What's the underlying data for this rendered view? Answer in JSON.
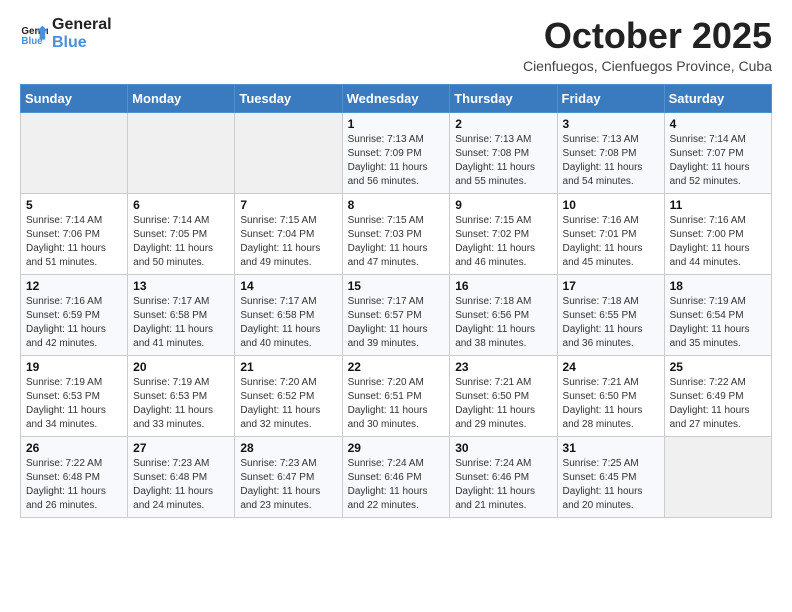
{
  "header": {
    "logo_line1": "General",
    "logo_line2": "Blue",
    "month_title": "October 2025",
    "subtitle": "Cienfuegos, Cienfuegos Province, Cuba"
  },
  "days_of_week": [
    "Sunday",
    "Monday",
    "Tuesday",
    "Wednesday",
    "Thursday",
    "Friday",
    "Saturday"
  ],
  "weeks": [
    [
      {
        "day": "",
        "info": ""
      },
      {
        "day": "",
        "info": ""
      },
      {
        "day": "",
        "info": ""
      },
      {
        "day": "1",
        "info": "Sunrise: 7:13 AM\nSunset: 7:09 PM\nDaylight: 11 hours and 56 minutes."
      },
      {
        "day": "2",
        "info": "Sunrise: 7:13 AM\nSunset: 7:08 PM\nDaylight: 11 hours and 55 minutes."
      },
      {
        "day": "3",
        "info": "Sunrise: 7:13 AM\nSunset: 7:08 PM\nDaylight: 11 hours and 54 minutes."
      },
      {
        "day": "4",
        "info": "Sunrise: 7:14 AM\nSunset: 7:07 PM\nDaylight: 11 hours and 52 minutes."
      }
    ],
    [
      {
        "day": "5",
        "info": "Sunrise: 7:14 AM\nSunset: 7:06 PM\nDaylight: 11 hours and 51 minutes."
      },
      {
        "day": "6",
        "info": "Sunrise: 7:14 AM\nSunset: 7:05 PM\nDaylight: 11 hours and 50 minutes."
      },
      {
        "day": "7",
        "info": "Sunrise: 7:15 AM\nSunset: 7:04 PM\nDaylight: 11 hours and 49 minutes."
      },
      {
        "day": "8",
        "info": "Sunrise: 7:15 AM\nSunset: 7:03 PM\nDaylight: 11 hours and 47 minutes."
      },
      {
        "day": "9",
        "info": "Sunrise: 7:15 AM\nSunset: 7:02 PM\nDaylight: 11 hours and 46 minutes."
      },
      {
        "day": "10",
        "info": "Sunrise: 7:16 AM\nSunset: 7:01 PM\nDaylight: 11 hours and 45 minutes."
      },
      {
        "day": "11",
        "info": "Sunrise: 7:16 AM\nSunset: 7:00 PM\nDaylight: 11 hours and 44 minutes."
      }
    ],
    [
      {
        "day": "12",
        "info": "Sunrise: 7:16 AM\nSunset: 6:59 PM\nDaylight: 11 hours and 42 minutes."
      },
      {
        "day": "13",
        "info": "Sunrise: 7:17 AM\nSunset: 6:58 PM\nDaylight: 11 hours and 41 minutes."
      },
      {
        "day": "14",
        "info": "Sunrise: 7:17 AM\nSunset: 6:58 PM\nDaylight: 11 hours and 40 minutes."
      },
      {
        "day": "15",
        "info": "Sunrise: 7:17 AM\nSunset: 6:57 PM\nDaylight: 11 hours and 39 minutes."
      },
      {
        "day": "16",
        "info": "Sunrise: 7:18 AM\nSunset: 6:56 PM\nDaylight: 11 hours and 38 minutes."
      },
      {
        "day": "17",
        "info": "Sunrise: 7:18 AM\nSunset: 6:55 PM\nDaylight: 11 hours and 36 minutes."
      },
      {
        "day": "18",
        "info": "Sunrise: 7:19 AM\nSunset: 6:54 PM\nDaylight: 11 hours and 35 minutes."
      }
    ],
    [
      {
        "day": "19",
        "info": "Sunrise: 7:19 AM\nSunset: 6:53 PM\nDaylight: 11 hours and 34 minutes."
      },
      {
        "day": "20",
        "info": "Sunrise: 7:19 AM\nSunset: 6:53 PM\nDaylight: 11 hours and 33 minutes."
      },
      {
        "day": "21",
        "info": "Sunrise: 7:20 AM\nSunset: 6:52 PM\nDaylight: 11 hours and 32 minutes."
      },
      {
        "day": "22",
        "info": "Sunrise: 7:20 AM\nSunset: 6:51 PM\nDaylight: 11 hours and 30 minutes."
      },
      {
        "day": "23",
        "info": "Sunrise: 7:21 AM\nSunset: 6:50 PM\nDaylight: 11 hours and 29 minutes."
      },
      {
        "day": "24",
        "info": "Sunrise: 7:21 AM\nSunset: 6:50 PM\nDaylight: 11 hours and 28 minutes."
      },
      {
        "day": "25",
        "info": "Sunrise: 7:22 AM\nSunset: 6:49 PM\nDaylight: 11 hours and 27 minutes."
      }
    ],
    [
      {
        "day": "26",
        "info": "Sunrise: 7:22 AM\nSunset: 6:48 PM\nDaylight: 11 hours and 26 minutes."
      },
      {
        "day": "27",
        "info": "Sunrise: 7:23 AM\nSunset: 6:48 PM\nDaylight: 11 hours and 24 minutes."
      },
      {
        "day": "28",
        "info": "Sunrise: 7:23 AM\nSunset: 6:47 PM\nDaylight: 11 hours and 23 minutes."
      },
      {
        "day": "29",
        "info": "Sunrise: 7:24 AM\nSunset: 6:46 PM\nDaylight: 11 hours and 22 minutes."
      },
      {
        "day": "30",
        "info": "Sunrise: 7:24 AM\nSunset: 6:46 PM\nDaylight: 11 hours and 21 minutes."
      },
      {
        "day": "31",
        "info": "Sunrise: 7:25 AM\nSunset: 6:45 PM\nDaylight: 11 hours and 20 minutes."
      },
      {
        "day": "",
        "info": ""
      }
    ]
  ]
}
